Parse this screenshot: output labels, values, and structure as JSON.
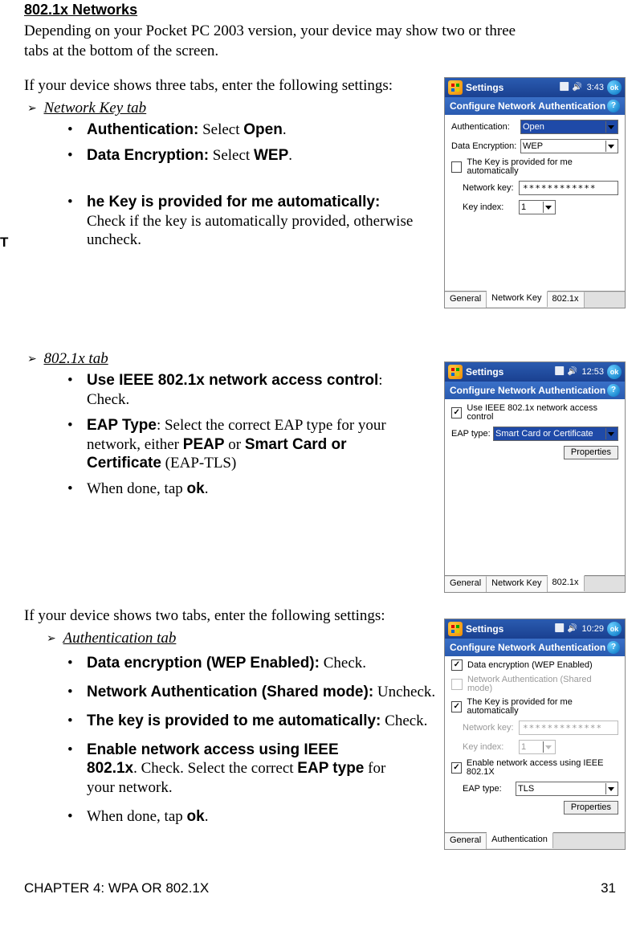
{
  "heading": "802.1x Networks",
  "intro": "Depending on your Pocket PC 2003 version, your device may show two or three tabs at the bottom of the screen.",
  "three_tabs_lead": "If your device shows three tabs, enter the following settings:",
  "t_letter": "T",
  "network_key_tab": {
    "title": "Network Key tab",
    "items": [
      {
        "bold": "Authentication:",
        "rest": " Select ",
        "bold2": "Open",
        "tail": "."
      },
      {
        "bold": "Data Encryption:",
        "rest": " Select ",
        "bold2": "WEP",
        "tail": "."
      },
      {
        "bold": "he Key is provided for me automatically:",
        "rest": " Check if the key is automatically provided, otherwise uncheck.",
        "bold2": "",
        "tail": ""
      }
    ]
  },
  "x8021_tab": {
    "title": "802.1x tab",
    "items": [
      {
        "bold": "Use IEEE 802.1x network access control",
        "rest": ": Check.",
        "bold2": "",
        "tail": ""
      },
      {
        "bold": "EAP Type",
        "rest": ": Select the correct EAP type for your network, either ",
        "bold2": "PEAP",
        "mid": " or ",
        "bold3": "Smart Card or Certificate",
        "tail": " (EAP-TLS)"
      },
      {
        "bold": "",
        "rest": "When done, tap ",
        "bold2": "ok",
        "tail": "."
      }
    ]
  },
  "two_tabs_lead": "If your device shows two tabs, enter the following settings:",
  "auth_tab": {
    "title": "Authentication tab",
    "items": [
      {
        "bold": "Data encryption (WEP Enabled):",
        "rest": " Check."
      },
      {
        "bold": "Network Authentication (Shared mode):",
        "rest": " Uncheck."
      },
      {
        "bold": "The key is provided to me automatically:",
        "rest": " Check."
      },
      {
        "bold": "Enable network access using IEEE 802.1x",
        "rest": ". Check. Select the correct ",
        "bold2": "EAP type",
        "tail": " for your network."
      },
      {
        "bold": "",
        "rest": " When done, tap ",
        "bold2": "ok",
        "tail": "."
      }
    ]
  },
  "footer_left": "CHAPTER 4: WPA OR 802.1X",
  "footer_right": "31",
  "device1": {
    "task_title": "Settings",
    "time": "3:43",
    "ok": "ok",
    "subtitle": "Configure Network Authentication",
    "help": "?",
    "auth_label": "Authentication:",
    "auth_value": "Open",
    "enc_label": "Data Encryption:",
    "enc_value": "WEP",
    "auto_check": "The Key is provided for me automatically",
    "netkey_label": "Network key:",
    "netkey_value": "************",
    "idx_label": "Key index:",
    "idx_value": "1",
    "tabs": [
      "General",
      "Network Key",
      "802.1x"
    ],
    "active_tab": 1
  },
  "device2": {
    "task_title": "Settings",
    "time": "12:53",
    "ok": "ok",
    "subtitle": "Configure Network Authentication",
    "help": "?",
    "use_check": "Use IEEE 802.1x network access control",
    "eap_label": "EAP type:",
    "eap_value": "Smart Card or Certificate",
    "props_btn": "Properties",
    "tabs": [
      "General",
      "Network Key",
      "802.1x"
    ],
    "active_tab": 2
  },
  "device3": {
    "task_title": "Settings",
    "time": "10:29",
    "ok": "ok",
    "subtitle": "Configure Network Authentication",
    "help": "?",
    "chk1": "Data encryption (WEP Enabled)",
    "chk2": "Network Authentication (Shared mode)",
    "chk3": "The Key is provided for me automatically",
    "netkey_label": "Network key:",
    "netkey_value": "*************",
    "idx_label": "Key index:",
    "idx_value": "1",
    "chk4": "Enable network access using IEEE 802.1X",
    "eap_label": "EAP type:",
    "eap_value": "TLS",
    "props_btn": "Properties",
    "tabs": [
      "General",
      "Authentication"
    ],
    "active_tab": 1
  }
}
